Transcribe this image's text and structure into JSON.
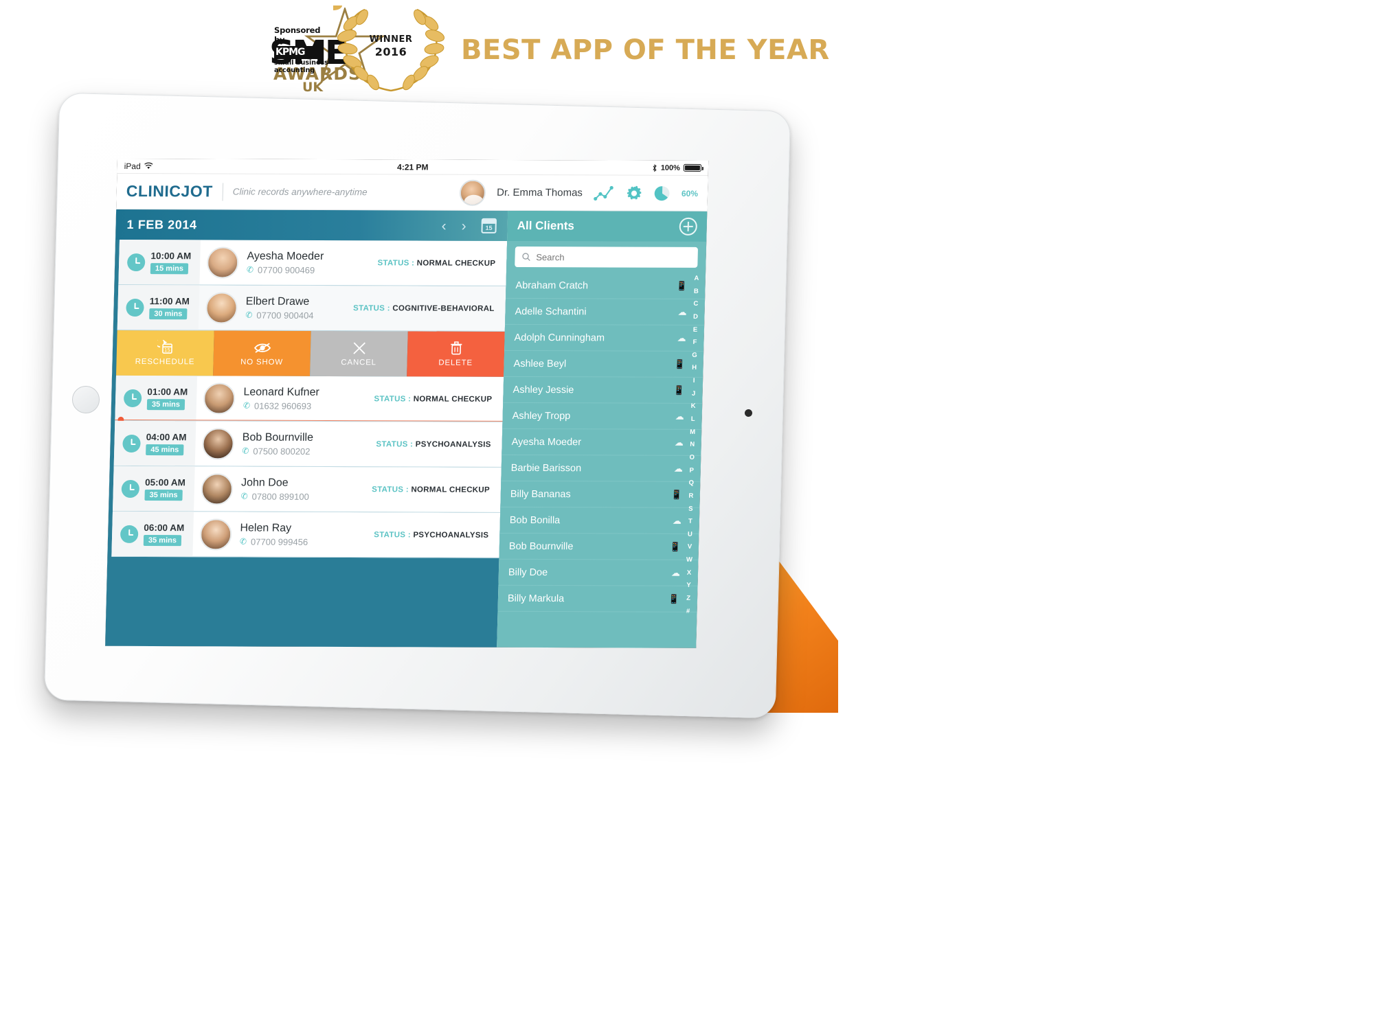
{
  "award": {
    "sme": "SME",
    "awards": "AWARDS",
    "uk": "UK",
    "sponsored_by": "Sponsored by",
    "kpmg": "KPMG",
    "kpmg_sub": "small business accounting",
    "winner": "WINNER",
    "year": "2016",
    "headline": "BEST APP OF THE YEAR",
    "gold": "#d7aa55"
  },
  "status_bar": {
    "device": "iPad",
    "wifi_icon": "wifi-icon",
    "time": "4:21 PM",
    "bluetooth_icon": "bluetooth-icon",
    "battery_pct": "100%"
  },
  "app_bar": {
    "logo": "CLINICJOT",
    "tagline": "Clinic records anywhere-anytime",
    "doctor": "Dr. Emma Thomas",
    "icons": [
      "chart-icon",
      "gear-icon",
      "pie-icon"
    ],
    "capacity": "60%",
    "accent_teal": "#5cc3c4",
    "logo_blue": "#1f6b8e"
  },
  "schedule": {
    "date": "1 FEB 2014",
    "prev_label": "‹",
    "next_label": "›",
    "calendar_day": "15",
    "appointments": [
      {
        "time": "10:00 AM",
        "duration": "15 mins",
        "name": "Ayesha Moeder",
        "phone": "07700 900469",
        "status_label": "STATUS :",
        "status": "NORMAL CHECKUP"
      },
      {
        "time": "11:00 AM",
        "duration": "30 mins",
        "name": "Elbert Drawe",
        "phone": "07700 900404",
        "status_label": "STATUS :",
        "status": "COGNITIVE-BEHAVIORAL"
      },
      {
        "time": "01:00 AM",
        "duration": "35 mins",
        "name": "Leonard Kufner",
        "phone": "01632 960693",
        "status_label": "STATUS :",
        "status": "NORMAL CHECKUP"
      },
      {
        "time": "04:00 AM",
        "duration": "45 mins",
        "name": "Bob Bournville",
        "phone": "07500 800202",
        "status_label": "STATUS :",
        "status": "PSYCHOANALYSIS"
      },
      {
        "time": "05:00 AM",
        "duration": "35 mins",
        "name": "John Doe",
        "phone": "07800 899100",
        "status_label": "STATUS :",
        "status": "NORMAL CHECKUP"
      },
      {
        "time": "06:00 AM",
        "duration": "35 mins",
        "name": "Helen Ray",
        "phone": "07700 999456",
        "status_label": "STATUS :",
        "status": "PSYCHOANALYSIS"
      }
    ],
    "actions": [
      {
        "label": "RESCHEDULE",
        "icon": "reschedule-calendar-icon",
        "color": "#f8c84e"
      },
      {
        "label": "NO SHOW",
        "icon": "eye-slash-icon",
        "color": "#f5922f"
      },
      {
        "label": "CANCEL",
        "icon": "close-x-icon",
        "color": "#bdbdbd"
      },
      {
        "label": "DELETE",
        "icon": "trash-icon",
        "color": "#f4613f"
      }
    ]
  },
  "clients": {
    "title": "All Clients",
    "add_label": "add-client-button",
    "search_placeholder": "Search",
    "search_value": "",
    "items": [
      {
        "name": "Abraham Cratch",
        "device": "phone-icon"
      },
      {
        "name": "Adelle Schantini",
        "device": "cloud-icon"
      },
      {
        "name": "Adolph Cunningham",
        "device": "cloud-icon"
      },
      {
        "name": "Ashlee Beyl",
        "device": "phone-icon"
      },
      {
        "name": "Ashley Jessie",
        "device": "phone-icon"
      },
      {
        "name": "Ashley Tropp",
        "device": "cloud-icon"
      },
      {
        "name": "Ayesha Moeder",
        "device": "cloud-icon"
      },
      {
        "name": "Barbie Barisson",
        "device": "cloud-icon"
      },
      {
        "name": "Billy Bananas",
        "device": "phone-icon"
      },
      {
        "name": "Bob Bonilla",
        "device": "cloud-icon"
      },
      {
        "name": "Bob Bournville",
        "device": "phone-icon"
      },
      {
        "name": "Billy Doe",
        "device": "cloud-icon"
      },
      {
        "name": "Billy Markula",
        "device": "phone-icon"
      }
    ],
    "alphabet": [
      "A",
      "B",
      "C",
      "D",
      "E",
      "F",
      "G",
      "H",
      "I",
      "J",
      "K",
      "L",
      "M",
      "N",
      "O",
      "P",
      "Q",
      "R",
      "S",
      "T",
      "U",
      "V",
      "W",
      "X",
      "Y",
      "Z",
      "#"
    ]
  }
}
